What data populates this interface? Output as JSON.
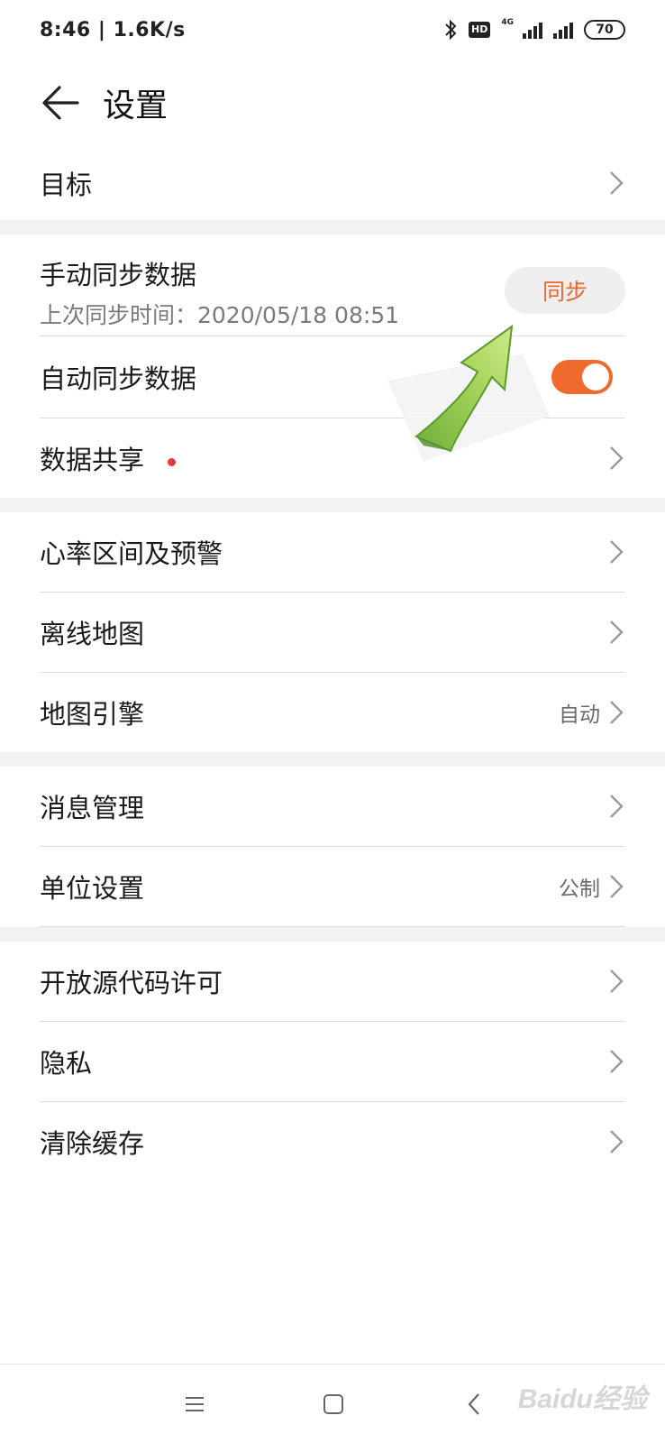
{
  "status_bar": {
    "time_speed": "8:46 | 1.6K/s",
    "hd": "HD",
    "network": "4G",
    "battery": "70"
  },
  "header": {
    "title": "设置"
  },
  "rows": {
    "goal": "目标",
    "manual_sync_title": "手动同步数据",
    "manual_sync_subtitle": "上次同步时间：2020/05/18 08:51",
    "sync_button": "同步",
    "auto_sync": "自动同步数据",
    "auto_sync_enabled": true,
    "data_share": "数据共享",
    "heart_rate": "心率区间及预警",
    "offline_map": "离线地图",
    "map_engine": "地图引擎",
    "map_engine_value": "自动",
    "message_mgmt": "消息管理",
    "unit_settings": "单位设置",
    "unit_settings_value": "公制",
    "open_source": "开放源代码许可",
    "privacy": "隐私",
    "clear_cache": "清除缓存"
  },
  "watermark": "Baidu经验",
  "colors": {
    "accent": "#ef6a2c",
    "sync_text": "#e8672b",
    "badge_dot": "#e5383b",
    "section_bg": "#f2f2f2"
  }
}
